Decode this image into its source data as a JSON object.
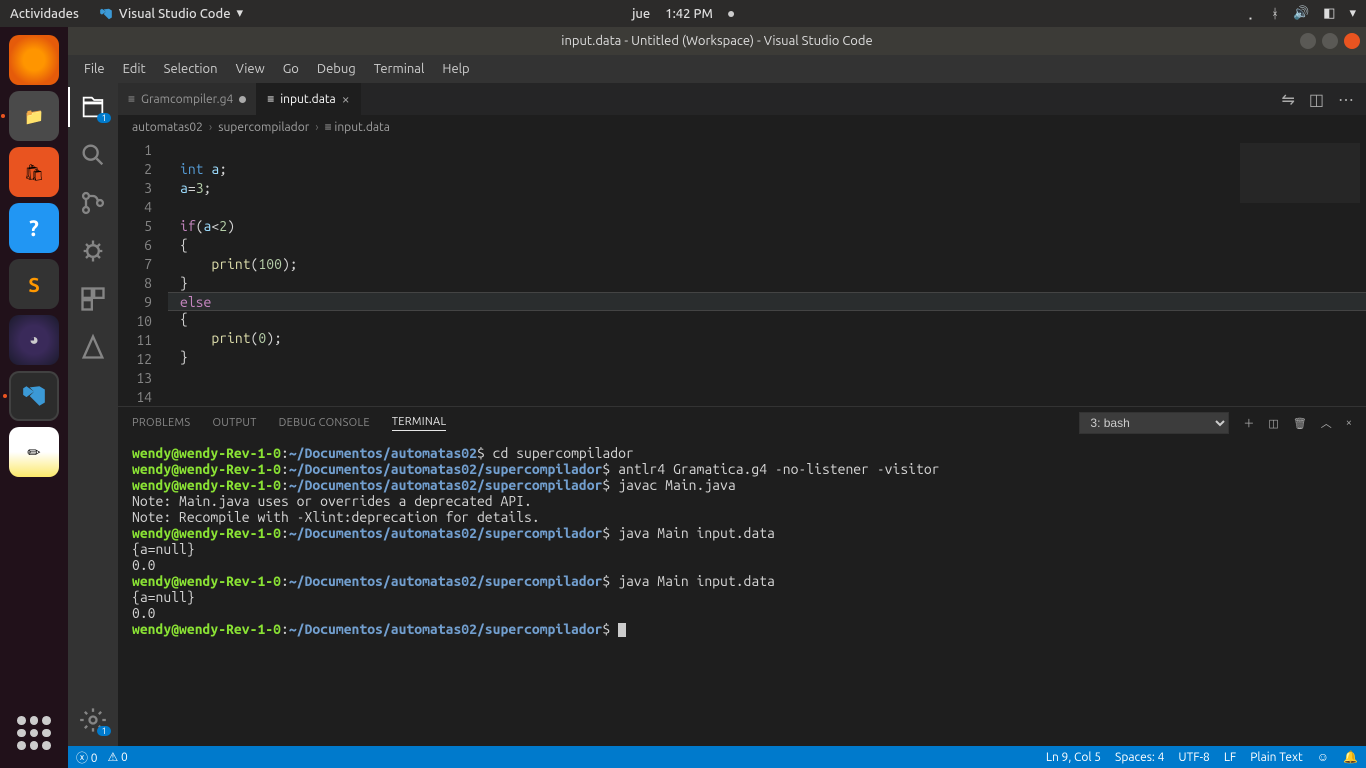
{
  "gnome": {
    "activities": "Actividades",
    "app_name": "Visual Studio Code",
    "day": "jue",
    "time": "1:42 PM"
  },
  "window": {
    "title": "input.data - Untitled (Workspace) - Visual Studio Code"
  },
  "menu": [
    "File",
    "Edit",
    "Selection",
    "View",
    "Go",
    "Debug",
    "Terminal",
    "Help"
  ],
  "activity_badges": {
    "explorer": "1",
    "settings": "1"
  },
  "tabs": [
    {
      "icon": "≡",
      "label": "Gramcompiler.g4",
      "dirty": true,
      "active": false
    },
    {
      "icon": "≡",
      "label": "input.data",
      "dirty": false,
      "active": true
    }
  ],
  "breadcrumb": [
    "automatas02",
    "supercompilador",
    "input.data"
  ],
  "code": {
    "lines": [
      "",
      "int a;",
      "a=3;",
      "",
      "if(a<2)",
      "{",
      "    print(100);",
      "}",
      "else",
      "{",
      "    print(0);",
      "}",
      "",
      ""
    ],
    "cursor_line": 9
  },
  "panel": {
    "tabs": [
      "PROBLEMS",
      "OUTPUT",
      "DEBUG CONSOLE",
      "TERMINAL"
    ],
    "active_tab": "TERMINAL",
    "shell_selector": "3: bash",
    "terminal_lines": [
      {
        "user": "wendy@wendy-Rev-1-0",
        "path": "~/Documentos/automatas02",
        "cmd": "cd supercompilador"
      },
      {
        "user": "wendy@wendy-Rev-1-0",
        "path": "~/Documentos/automatas02/supercompilador",
        "cmd": "antlr4 Gramatica.g4 -no-listener -visitor"
      },
      {
        "user": "wendy@wendy-Rev-1-0",
        "path": "~/Documentos/automatas02/supercompilador",
        "cmd": "javac Main.java"
      },
      {
        "plain": "Note: Main.java uses or overrides a deprecated API."
      },
      {
        "plain": "Note: Recompile with -Xlint:deprecation for details."
      },
      {
        "user": "wendy@wendy-Rev-1-0",
        "path": "~/Documentos/automatas02/supercompilador",
        "cmd": "java Main input.data"
      },
      {
        "plain": "{a=null}"
      },
      {
        "plain": "0.0"
      },
      {
        "user": "wendy@wendy-Rev-1-0",
        "path": "~/Documentos/automatas02/supercompilador",
        "cmd": "java Main input.data"
      },
      {
        "plain": "{a=null}"
      },
      {
        "plain": "0.0"
      },
      {
        "user": "wendy@wendy-Rev-1-0",
        "path": "~/Documentos/automatas02/supercompilador",
        "cmd": "",
        "cursor": true
      }
    ]
  },
  "status": {
    "errors": "0",
    "warnings": "0",
    "lncol": "Ln 9, Col 5",
    "spaces": "Spaces: 4",
    "encoding": "UTF-8",
    "eol": "LF",
    "lang": "Plain Text"
  }
}
